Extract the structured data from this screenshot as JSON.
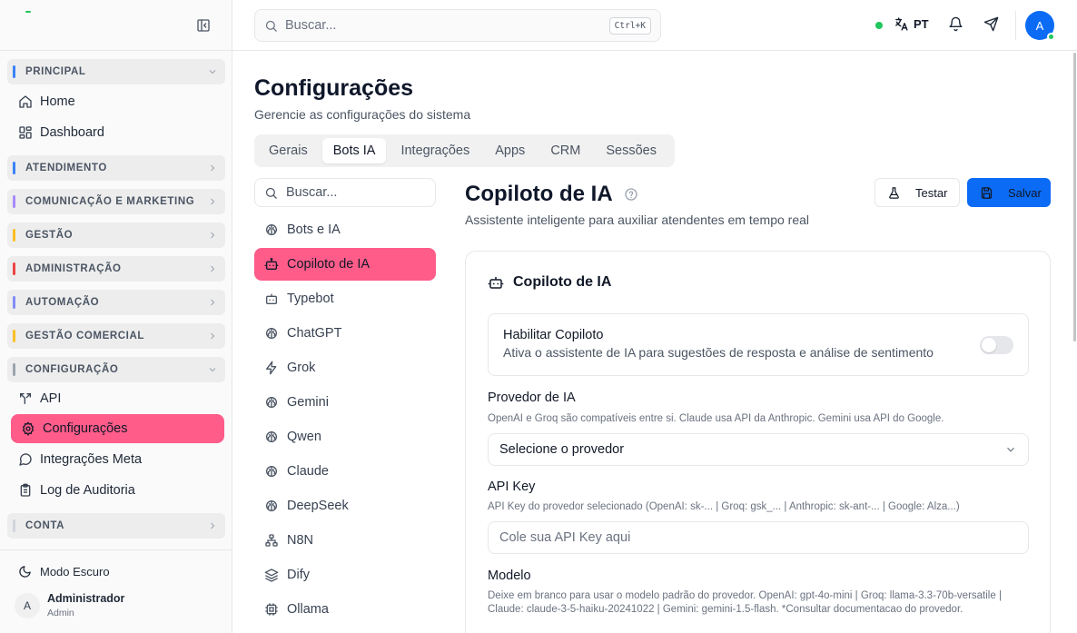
{
  "colors": {
    "accent_pink": "#ff5c8a",
    "primary_blue": "#0b6bf5",
    "online_green": "#22c55e",
    "group_principal": "#3b82f6",
    "group_atendimento": "#3b82f6",
    "group_comunicacao": "#a78bfa",
    "group_gestao": "#fbbf24",
    "group_administracao": "#ef4444",
    "group_automacao": "#818cf8",
    "group_gestao_comercial": "#fbbf24",
    "group_configuracao": "#9ca3af",
    "group_conta": "#d1d5db"
  },
  "sidebar": {
    "collapse_icon": "panel-left-icon",
    "groups": {
      "principal": "PRINCIPAL",
      "atendimento": "ATENDIMENTO",
      "comunicacao": "COMUNICAÇÃO E MARKETING",
      "gestao": "GESTÃO",
      "administracao": "ADMINISTRAÇÃO",
      "automacao": "AUTOMAÇÃO",
      "gestao_comercial": "GESTÃO COMERCIAL",
      "configuracao": "CONFIGURAÇÃO",
      "conta": "CONTA"
    },
    "items": {
      "home": "Home",
      "dashboard": "Dashboard",
      "api": "API",
      "configuracoes": "Configurações",
      "integracoes_meta": "Integrações Meta",
      "log_auditoria": "Log de Auditoria"
    },
    "dark_mode": "Modo Escuro",
    "user": {
      "initial": "A",
      "name": "Administrador",
      "role": "Admin"
    }
  },
  "header": {
    "search_placeholder": "Buscar...",
    "shortcut": "Ctrl+K",
    "language": "PT",
    "avatar_initial": "A"
  },
  "page": {
    "title": "Configurações",
    "subtitle": "Gerencie as configurações do sistema",
    "tabs": [
      "Gerais",
      "Bots IA",
      "Integrações",
      "Apps",
      "CRM",
      "Sessões"
    ],
    "active_tab": "Bots IA"
  },
  "subnav": {
    "search_placeholder": "Buscar...",
    "items": [
      "Bots e IA",
      "Copiloto de IA",
      "Typebot",
      "ChatGPT",
      "Grok",
      "Gemini",
      "Qwen",
      "Claude",
      "DeepSeek",
      "N8N",
      "Dify",
      "Ollama"
    ],
    "active": "Copiloto de IA"
  },
  "content": {
    "title": "Copiloto de IA",
    "subtitle": "Assistente inteligente para auxiliar atendentes em tempo real",
    "test_button": "Testar",
    "save_button": "Salvar",
    "card_title": "Copiloto de IA",
    "enable": {
      "title": "Habilitar Copiloto",
      "description": "Ativa o assistente de IA para sugestões de resposta e análise de sentimento",
      "enabled": false
    },
    "provider": {
      "label": "Provedor de IA",
      "help": "OpenAI e Groq são compatíveis entre si. Claude usa API da Anthropic. Gemini usa API do Google.",
      "value": "Selecione o provedor"
    },
    "api_key": {
      "label": "API Key",
      "help": "API Key do provedor selecionado (OpenAI: sk-... | Groq: gsk_... | Anthropic: sk-ant-... | Google: Alza...)",
      "placeholder": "Cole sua API Key aqui"
    },
    "model": {
      "label": "Modelo",
      "help": "Deixe em branco para usar o modelo padrão do provedor. OpenAI: gpt-4o-mini | Groq: llama-3.3-70b-versatile | Claude: claude-3-5-haiku-20241022 | Gemini: gemini-1.5-flash. *Consultar documentacao do provedor."
    }
  }
}
